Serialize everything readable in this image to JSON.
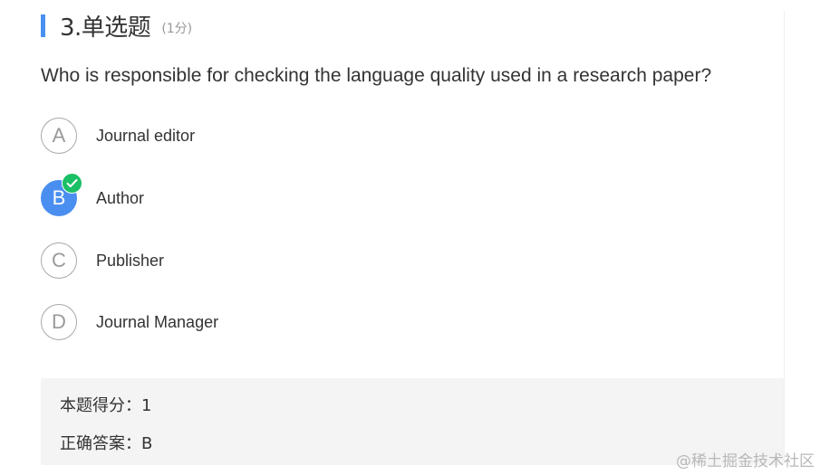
{
  "question": {
    "title": "3.单选题",
    "points": "(1分)",
    "text": "Who is responsible for checking the language quality used in a research paper?"
  },
  "options": [
    {
      "letter": "A",
      "label": "Journal editor",
      "selected": false
    },
    {
      "letter": "B",
      "label": "Author",
      "selected": true
    },
    {
      "letter": "C",
      "label": "Publisher",
      "selected": false
    },
    {
      "letter": "D",
      "label": "Journal Manager",
      "selected": false
    }
  ],
  "result": {
    "score_text": "本题得分：1",
    "answer_text": "正确答案：B"
  },
  "watermark": "@稀土掘金技术社区",
  "colors": {
    "accent": "#4a90f0",
    "selected": "#4a8ff0",
    "correct_badge": "#1bbf66",
    "panel_bg": "#f4f4f4"
  },
  "icons": {
    "correct": "check-icon"
  }
}
